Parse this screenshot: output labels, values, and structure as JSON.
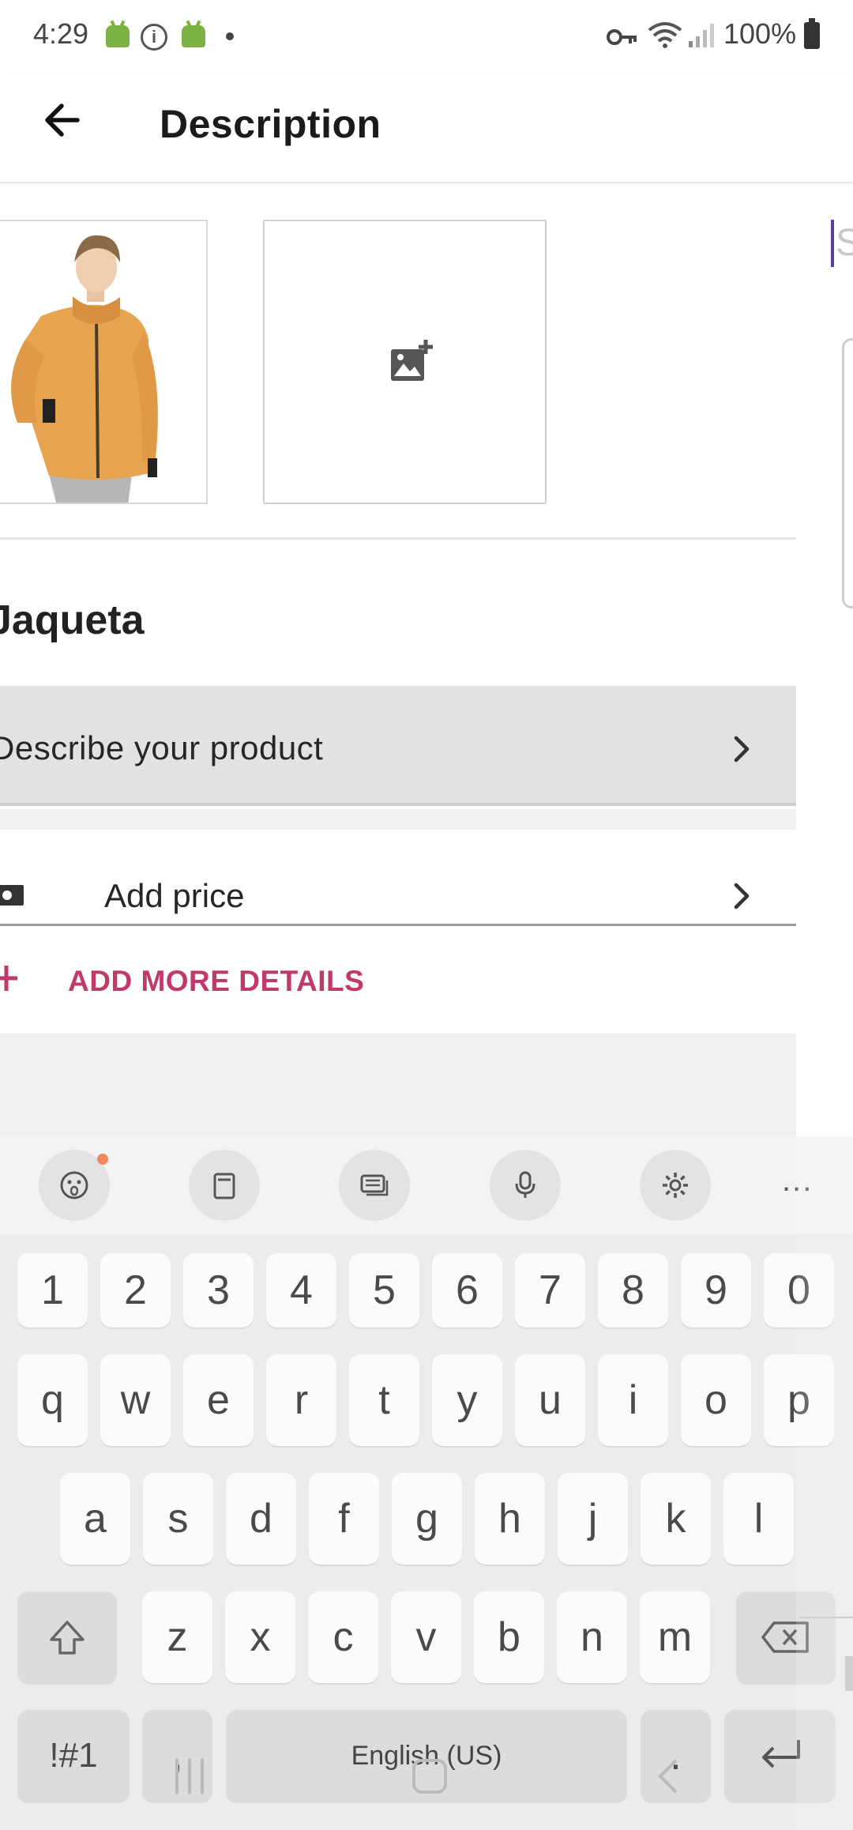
{
  "status_bar": {
    "time": "4:29",
    "battery": "100%",
    "icons": [
      "android-icon",
      "info-icon",
      "android-icon",
      "dot-icon",
      "vpn-key-icon",
      "wifi-icon",
      "signal-icon",
      "battery-icon"
    ]
  },
  "app_bar": {
    "title": "Description",
    "back_icon": "arrow-back-icon"
  },
  "images": {
    "photo_alt": "product-photo",
    "add_photo_icon": "add-photo-icon"
  },
  "product": {
    "name": "Jaqueta",
    "describe_label": "Describe your product",
    "price_label": "Add price",
    "more_details_label": "ADD MORE DETAILS"
  },
  "keyboard": {
    "toolbar": [
      "emoji-icon",
      "clipboard-icon",
      "keyboard-mode-icon",
      "microphone-icon",
      "settings-icon",
      "more-icon"
    ],
    "more_label": "...",
    "row_numbers": [
      "1",
      "2",
      "3",
      "4",
      "5",
      "6",
      "7",
      "8",
      "9",
      "0"
    ],
    "row_1": [
      "q",
      "w",
      "e",
      "r",
      "t",
      "y",
      "u",
      "i",
      "o",
      "p"
    ],
    "row_2": [
      "a",
      "s",
      "d",
      "f",
      "g",
      "h",
      "j",
      "k",
      "l"
    ],
    "row_3": [
      "z",
      "x",
      "c",
      "v",
      "b",
      "n",
      "m"
    ],
    "symbols_label": "!#1",
    "comma_label": ",",
    "space_label": "English (US)",
    "period_label": ".",
    "colors": {
      "accent": "#c0396b",
      "cursor": "#5b3fa6",
      "keyboard_bg": "#ececec"
    }
  }
}
